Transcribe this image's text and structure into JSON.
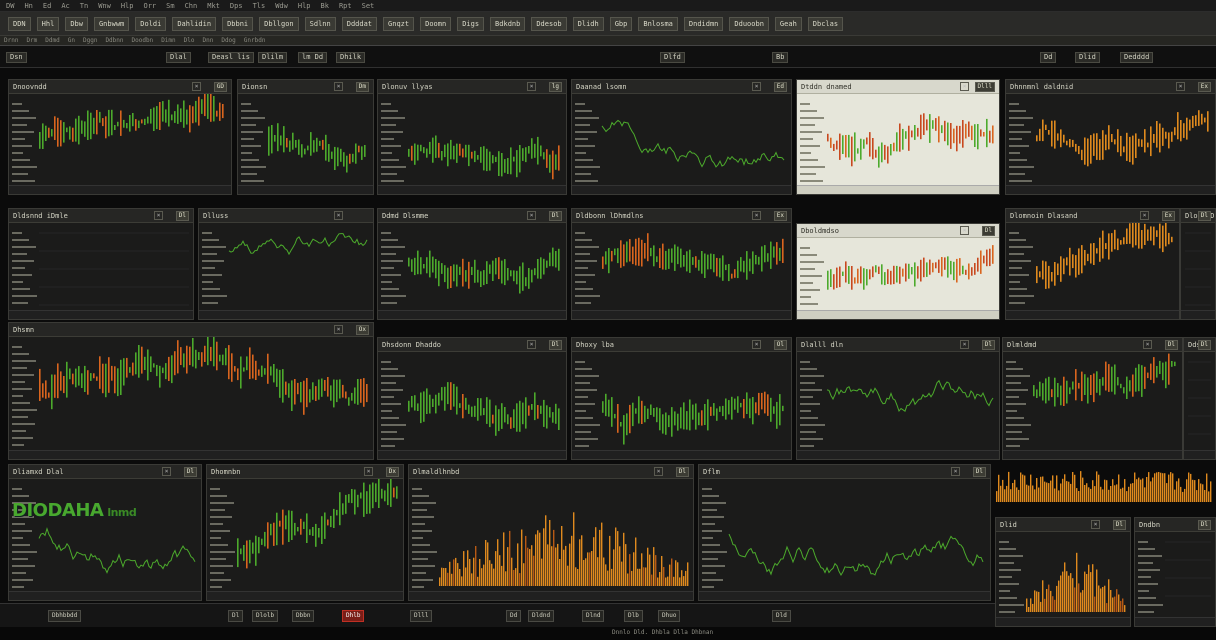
{
  "colors": {
    "bull": "#4caa2c",
    "bear": "#d9651e",
    "amber": "#e08a1e",
    "dark_bg": "#1b1b1a",
    "light_bg": "#e6e6da"
  },
  "menubar": [
    "DW",
    "Hn",
    "Ed",
    "Ac",
    "Tn",
    "Wnw",
    "Hlp",
    "Orr",
    "Sm",
    "Chn",
    "Mkt",
    "Dps",
    "Tls",
    "Wdw",
    "Hlp",
    "Bk",
    "Rpt",
    "Set"
  ],
  "toolbar": [
    "DDN",
    "Hhl",
    "Dbw",
    "Gnbwwm",
    "Doldi",
    "Dahlidin",
    "Dbbni",
    "Dbllgon",
    "Sdlnn",
    "Ddddat",
    "Gnqzt",
    "Doomn",
    "Digs",
    "Bdkdnb",
    "Ddesob",
    "Dlidh",
    "Gbp",
    "Bnlosma",
    "Dndidmn",
    "Dduoobn",
    "Geah",
    "Dbclas"
  ],
  "subbar": [
    "Drnn",
    "Drm",
    "Ddmd",
    "Gn",
    "Dggn",
    "Ddbnn",
    "Doodbn",
    "Dimn",
    "Dlo",
    "Dnn",
    "Ddog",
    "Gnrbdn"
  ],
  "toolbar3": [
    "Dsn",
    "Dlal",
    "Deasl lis",
    "Dlilm",
    "lm Dd",
    "Dhilk",
    "Dlfd",
    "Bb",
    "Dd",
    "Dlid",
    "Dedddd"
  ],
  "big_label": "DIODAHA",
  "big_label_suffix": "lnmd",
  "panels": [
    {
      "title": "Dnoovndd",
      "tag": "GD"
    },
    {
      "title": "Dionsn",
      "tag": "Dm"
    },
    {
      "title": "Dlonuv llyas",
      "tag": "lg"
    },
    {
      "title": "Daanad lsomn",
      "tag": "Ed"
    },
    {
      "title": "Dtddn dnamed",
      "tag": "Dlll"
    },
    {
      "title": "Dhnnmnl daldnid",
      "tag": "Ex"
    },
    {
      "title": "Dldsnnd iDmle",
      "tag": "Dl"
    },
    {
      "title": "Dlluss",
      "tag": ""
    },
    {
      "title": "Ddmd Dlsmme",
      "tag": "Dl"
    },
    {
      "title": "Dldbonn lDhmdlns",
      "tag": "Ex"
    },
    {
      "title": "Dboldmdso",
      "tag": "Dl"
    },
    {
      "title": "Dlomnoin Dlasand",
      "tag": "Ex"
    },
    {
      "title": "Dlood Dlnsd",
      "tag": "Dl"
    },
    {
      "title": "Dhsmn",
      "tag": "Ox"
    },
    {
      "title": "Dhsdonn Dhaddo",
      "tag": "Dl"
    },
    {
      "title": "Dhoxy lba",
      "tag": "Ol"
    },
    {
      "title": "Dlalll dln",
      "tag": "Dl"
    },
    {
      "title": "Dlmldmd",
      "tag": "Dl"
    },
    {
      "title": "Ddsbn",
      "tag": "Dl"
    },
    {
      "title": "Dliamxd Dlal",
      "tag": "Dl"
    },
    {
      "title": "Dhomnbn",
      "tag": "Dx"
    },
    {
      "title": "Dlmaldlhnbd",
      "tag": "Dl"
    },
    {
      "title": "Dflm",
      "tag": "Dl"
    },
    {
      "title": "Dlid",
      "tag": "Dl"
    },
    {
      "title": "Dndbn",
      "tag": "Dl"
    }
  ],
  "footer": [
    "Dbhbbdd",
    "Dl",
    "Dlolb",
    "Dbbn",
    "Dhlb",
    "Dlll",
    "Dd",
    "Dldnd",
    "Dlnd",
    "Dlb",
    "Dhuo",
    "Dld"
  ],
  "status": "Dnnlo Dld. Dhbla Dlla Dhbnan"
}
